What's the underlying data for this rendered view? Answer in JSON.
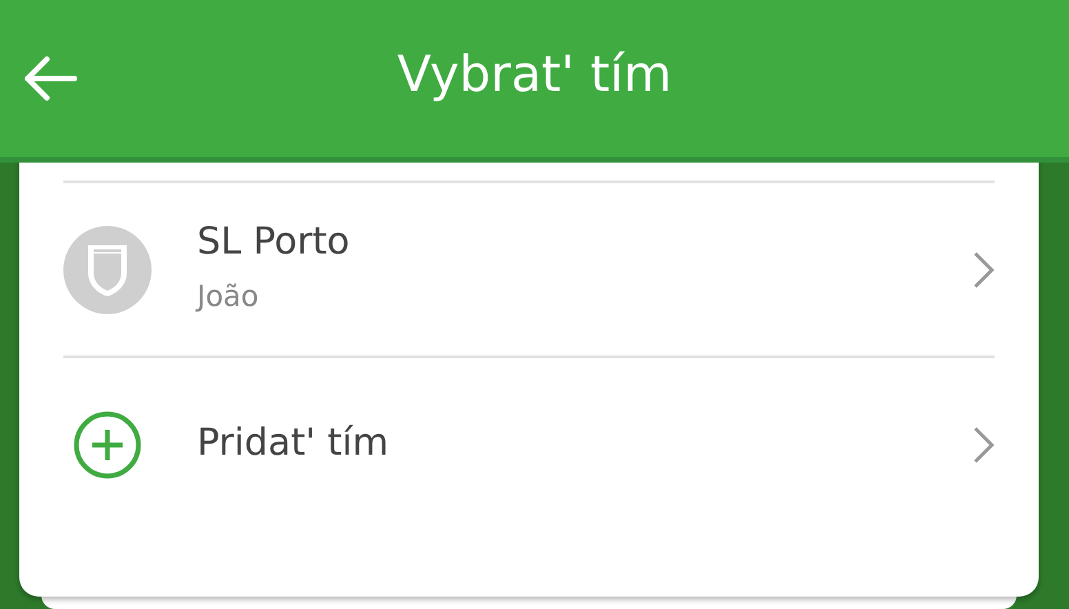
{
  "header": {
    "title": "Vybrat' tím"
  },
  "items": [
    {
      "kind": "team",
      "name": "SL Porto",
      "subtitle": "João"
    },
    {
      "kind": "add",
      "label": "Pridat' tím"
    }
  ]
}
